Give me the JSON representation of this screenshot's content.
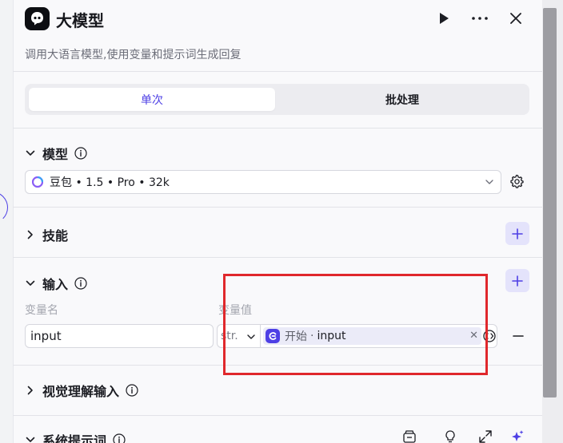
{
  "node": {
    "title": "大模型",
    "description": "调用大语言模型,使用变量和提示词生成回复"
  },
  "mode_tabs": [
    {
      "label": "单次",
      "active": true
    },
    {
      "label": "批处理",
      "active": false
    }
  ],
  "sections": {
    "model": {
      "label": "模型",
      "selected": "豆包 • 1.5 • Pro • 32k"
    },
    "skills": {
      "label": "技能"
    },
    "input": {
      "label": "输入",
      "col_name": "变量名",
      "col_value": "变量值",
      "rows": [
        {
          "name": "input",
          "type": "str.",
          "source_node": "开始",
          "separator": "·",
          "source_var": "input"
        }
      ]
    },
    "vision_input": {
      "label": "视觉理解输入"
    },
    "system_prompt": {
      "label": "系统提示词"
    }
  },
  "colors": {
    "accent": "#4e40e5",
    "highlight_box": "#e0282c"
  },
  "icons": [
    "play-icon",
    "more-icon",
    "close-icon",
    "info-icon",
    "gear-icon",
    "plus-icon",
    "minus-icon",
    "clear-icon",
    "chevron-down-icon",
    "chevron-right-icon",
    "sparkle-icon",
    "expand-icon",
    "bulb-icon",
    "library-icon"
  ]
}
